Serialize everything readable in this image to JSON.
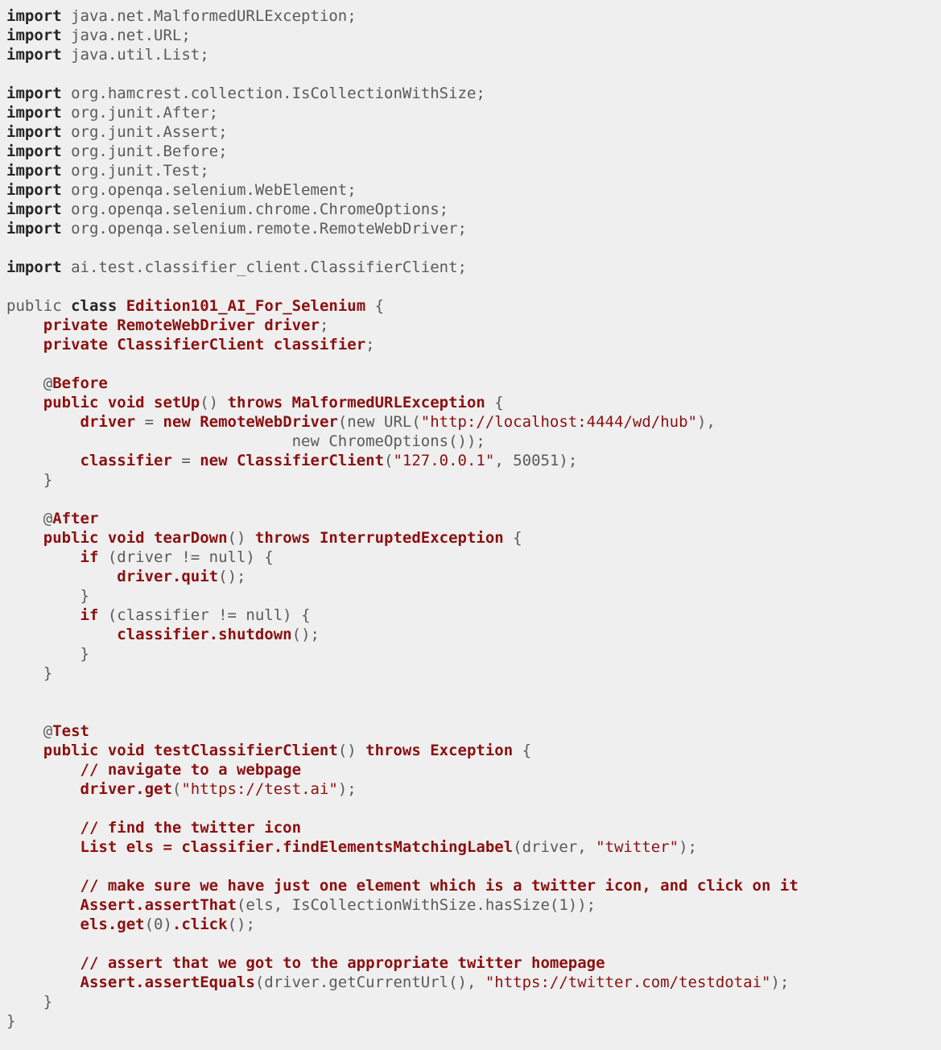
{
  "editor": {
    "language": "java",
    "background_color": "#efefef",
    "plain_color": "#5a5a5a",
    "keyword_color": "#262626",
    "identifier_color": "#8b1010",
    "string_color": "#8b1010",
    "comment_color": "#8b1010",
    "font_size_px": 19,
    "line_height_px": 24,
    "class_name": "Edition101_AI_For_Selenium",
    "total_lines": 54
  },
  "code": {
    "lines": [
      {
        "n": 1,
        "tokens": [
          {
            "t": "import",
            "c": "kw"
          },
          {
            "t": " java.net.MalformedURLException;",
            "c": "plain"
          }
        ]
      },
      {
        "n": 2,
        "tokens": [
          {
            "t": "import",
            "c": "kw"
          },
          {
            "t": " java.net.URL;",
            "c": "plain"
          }
        ]
      },
      {
        "n": 3,
        "tokens": [
          {
            "t": "import",
            "c": "kw"
          },
          {
            "t": " java.util.List;",
            "c": "plain"
          }
        ]
      },
      {
        "n": 4,
        "tokens": []
      },
      {
        "n": 5,
        "tokens": [
          {
            "t": "import",
            "c": "kw"
          },
          {
            "t": " org.hamcrest.collection.IsCollectionWithSize;",
            "c": "plain"
          }
        ]
      },
      {
        "n": 6,
        "tokens": [
          {
            "t": "import",
            "c": "kw"
          },
          {
            "t": " org.junit.After;",
            "c": "plain"
          }
        ]
      },
      {
        "n": 7,
        "tokens": [
          {
            "t": "import",
            "c": "kw"
          },
          {
            "t": " org.junit.Assert;",
            "c": "plain"
          }
        ]
      },
      {
        "n": 8,
        "tokens": [
          {
            "t": "import",
            "c": "kw"
          },
          {
            "t": " org.junit.Before;",
            "c": "plain"
          }
        ]
      },
      {
        "n": 9,
        "tokens": [
          {
            "t": "import",
            "c": "kw"
          },
          {
            "t": " org.junit.Test;",
            "c": "plain"
          }
        ]
      },
      {
        "n": 10,
        "tokens": [
          {
            "t": "import",
            "c": "kw"
          },
          {
            "t": " org.openqa.selenium.WebElement;",
            "c": "plain"
          }
        ]
      },
      {
        "n": 11,
        "tokens": [
          {
            "t": "import",
            "c": "kw"
          },
          {
            "t": " org.openqa.selenium.chrome.ChromeOptions;",
            "c": "plain"
          }
        ]
      },
      {
        "n": 12,
        "tokens": [
          {
            "t": "import",
            "c": "kw"
          },
          {
            "t": " org.openqa.selenium.remote.RemoteWebDriver;",
            "c": "plain"
          }
        ]
      },
      {
        "n": 13,
        "tokens": []
      },
      {
        "n": 14,
        "tokens": [
          {
            "t": "import",
            "c": "kw"
          },
          {
            "t": " ai.test.classifier_client.ClassifierClient;",
            "c": "plain"
          }
        ]
      },
      {
        "n": 15,
        "tokens": []
      },
      {
        "n": 16,
        "tokens": [
          {
            "t": "public ",
            "c": "kwp"
          },
          {
            "t": "class",
            "c": "kw"
          },
          {
            "t": " ",
            "c": "plain"
          },
          {
            "t": "Edition101_AI_For_Selenium",
            "c": "id"
          },
          {
            "t": " {",
            "c": "plain"
          }
        ]
      },
      {
        "n": 17,
        "tokens": [
          {
            "t": "    ",
            "c": "plain"
          },
          {
            "t": "private RemoteWebDriver driver",
            "c": "id"
          },
          {
            "t": ";",
            "c": "plain"
          }
        ]
      },
      {
        "n": 18,
        "tokens": [
          {
            "t": "    ",
            "c": "plain"
          },
          {
            "t": "private ClassifierClient classifier",
            "c": "id"
          },
          {
            "t": ";",
            "c": "plain"
          }
        ]
      },
      {
        "n": 19,
        "tokens": []
      },
      {
        "n": 20,
        "tokens": [
          {
            "t": "    @",
            "c": "plain"
          },
          {
            "t": "Before",
            "c": "ann"
          }
        ]
      },
      {
        "n": 21,
        "tokens": [
          {
            "t": "    ",
            "c": "plain"
          },
          {
            "t": "public void setUp",
            "c": "id"
          },
          {
            "t": "() ",
            "c": "plain"
          },
          {
            "t": "throws MalformedURLException",
            "c": "id"
          },
          {
            "t": " {",
            "c": "plain"
          }
        ]
      },
      {
        "n": 22,
        "tokens": [
          {
            "t": "        ",
            "c": "plain"
          },
          {
            "t": "driver",
            "c": "id"
          },
          {
            "t": " = ",
            "c": "plain"
          },
          {
            "t": "new RemoteWebDriver",
            "c": "id"
          },
          {
            "t": "(new URL(",
            "c": "plain"
          },
          {
            "t": "\"http://localhost:4444/wd/hub\"",
            "c": "str"
          },
          {
            "t": "),",
            "c": "plain"
          }
        ]
      },
      {
        "n": 23,
        "tokens": [
          {
            "t": "                               new ChromeOptions());",
            "c": "plain"
          }
        ]
      },
      {
        "n": 24,
        "tokens": [
          {
            "t": "        ",
            "c": "plain"
          },
          {
            "t": "classifier",
            "c": "id"
          },
          {
            "t": " = ",
            "c": "plain"
          },
          {
            "t": "new ClassifierClient",
            "c": "id"
          },
          {
            "t": "(",
            "c": "plain"
          },
          {
            "t": "\"127.0.0.1\"",
            "c": "str"
          },
          {
            "t": ", ",
            "c": "plain"
          },
          {
            "t": "50051",
            "c": "plain"
          },
          {
            "t": ");",
            "c": "plain"
          }
        ]
      },
      {
        "n": 25,
        "tokens": [
          {
            "t": "    }",
            "c": "plain"
          }
        ]
      },
      {
        "n": 26,
        "tokens": []
      },
      {
        "n": 27,
        "tokens": [
          {
            "t": "    @",
            "c": "plain"
          },
          {
            "t": "After",
            "c": "ann"
          }
        ]
      },
      {
        "n": 28,
        "tokens": [
          {
            "t": "    ",
            "c": "plain"
          },
          {
            "t": "public void tearDown",
            "c": "id"
          },
          {
            "t": "() ",
            "c": "plain"
          },
          {
            "t": "throws InterruptedException",
            "c": "id"
          },
          {
            "t": " {",
            "c": "plain"
          }
        ]
      },
      {
        "n": 29,
        "tokens": [
          {
            "t": "        ",
            "c": "plain"
          },
          {
            "t": "if",
            "c": "id"
          },
          {
            "t": " (driver != null) {",
            "c": "plain"
          }
        ]
      },
      {
        "n": 30,
        "tokens": [
          {
            "t": "            ",
            "c": "plain"
          },
          {
            "t": "driver.quit",
            "c": "id"
          },
          {
            "t": "();",
            "c": "plain"
          }
        ]
      },
      {
        "n": 31,
        "tokens": [
          {
            "t": "        }",
            "c": "plain"
          }
        ]
      },
      {
        "n": 32,
        "tokens": [
          {
            "t": "        ",
            "c": "plain"
          },
          {
            "t": "if",
            "c": "id"
          },
          {
            "t": " (classifier != null) {",
            "c": "plain"
          }
        ]
      },
      {
        "n": 33,
        "tokens": [
          {
            "t": "            ",
            "c": "plain"
          },
          {
            "t": "classifier.shutdown",
            "c": "id"
          },
          {
            "t": "();",
            "c": "plain"
          }
        ]
      },
      {
        "n": 34,
        "tokens": [
          {
            "t": "        }",
            "c": "plain"
          }
        ]
      },
      {
        "n": 35,
        "tokens": [
          {
            "t": "    }",
            "c": "plain"
          }
        ]
      },
      {
        "n": 36,
        "tokens": []
      },
      {
        "n": 37,
        "tokens": []
      },
      {
        "n": 38,
        "tokens": [
          {
            "t": "    @",
            "c": "plain"
          },
          {
            "t": "Test",
            "c": "ann"
          }
        ]
      },
      {
        "n": 39,
        "tokens": [
          {
            "t": "    ",
            "c": "plain"
          },
          {
            "t": "public void testClassifierClient",
            "c": "id"
          },
          {
            "t": "() ",
            "c": "plain"
          },
          {
            "t": "throws Exception",
            "c": "id"
          },
          {
            "t": " {",
            "c": "plain"
          }
        ]
      },
      {
        "n": 40,
        "tokens": [
          {
            "t": "        ",
            "c": "plain"
          },
          {
            "t": "// navigate to a webpage",
            "c": "com"
          }
        ]
      },
      {
        "n": 41,
        "tokens": [
          {
            "t": "        ",
            "c": "plain"
          },
          {
            "t": "driver.get",
            "c": "id"
          },
          {
            "t": "(",
            "c": "plain"
          },
          {
            "t": "\"https://test.ai\"",
            "c": "str"
          },
          {
            "t": ");",
            "c": "plain"
          }
        ]
      },
      {
        "n": 42,
        "tokens": []
      },
      {
        "n": 43,
        "tokens": [
          {
            "t": "        ",
            "c": "plain"
          },
          {
            "t": "// find the twitter icon",
            "c": "com"
          }
        ]
      },
      {
        "n": 44,
        "tokens": [
          {
            "t": "        ",
            "c": "plain"
          },
          {
            "t": "List els = classifier.findElementsMatchingLabel",
            "c": "id"
          },
          {
            "t": "(driver, ",
            "c": "plain"
          },
          {
            "t": "\"twitter\"",
            "c": "str"
          },
          {
            "t": ");",
            "c": "plain"
          }
        ]
      },
      {
        "n": 45,
        "tokens": []
      },
      {
        "n": 46,
        "tokens": [
          {
            "t": "        ",
            "c": "plain"
          },
          {
            "t": "// make sure we have just one element which is a twitter icon, and click on it",
            "c": "com"
          }
        ]
      },
      {
        "n": 47,
        "tokens": [
          {
            "t": "        ",
            "c": "plain"
          },
          {
            "t": "Assert.assertThat",
            "c": "id"
          },
          {
            "t": "(els, IsCollectionWithSize.hasSize(1));",
            "c": "plain"
          }
        ]
      },
      {
        "n": 48,
        "tokens": [
          {
            "t": "        ",
            "c": "plain"
          },
          {
            "t": "els.get",
            "c": "id"
          },
          {
            "t": "(0)",
            "c": "plain"
          },
          {
            "t": ".click",
            "c": "id"
          },
          {
            "t": "();",
            "c": "plain"
          }
        ]
      },
      {
        "n": 49,
        "tokens": []
      },
      {
        "n": 50,
        "tokens": [
          {
            "t": "        ",
            "c": "plain"
          },
          {
            "t": "// assert that we got to the appropriate twitter homepage",
            "c": "com"
          }
        ]
      },
      {
        "n": 51,
        "tokens": [
          {
            "t": "        ",
            "c": "plain"
          },
          {
            "t": "Assert.assertEquals",
            "c": "id"
          },
          {
            "t": "(driver.getCurrentUrl(), ",
            "c": "plain"
          },
          {
            "t": "\"https://twitter.com/testdotai\"",
            "c": "str"
          },
          {
            "t": ");",
            "c": "plain"
          }
        ]
      },
      {
        "n": 52,
        "tokens": [
          {
            "t": "    }",
            "c": "plain"
          }
        ]
      },
      {
        "n": 53,
        "tokens": [
          {
            "t": "}",
            "c": "plain"
          }
        ]
      },
      {
        "n": 54,
        "tokens": []
      }
    ]
  }
}
